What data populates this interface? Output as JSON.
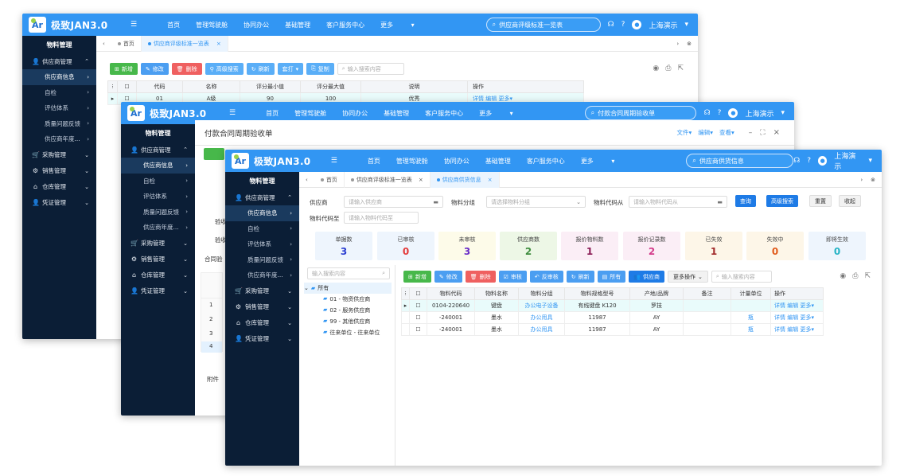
{
  "app": {
    "name": "极致JAN3.0",
    "logo_letter": "Ar"
  },
  "topnav": [
    "首页",
    "管理驾驶舱",
    "协同办公",
    "基础管理",
    "客户服务中心",
    "更多"
  ],
  "user": "上海演示",
  "w1": {
    "search": "供应商评级标准一览表",
    "tabs": [
      "首页",
      "供应商评级标准一览表"
    ],
    "toolbar": [
      "新增",
      "修改",
      "删除",
      "高级搜索",
      "刷新",
      "套打",
      "复制"
    ],
    "search_placeholder": "输入搜索内容",
    "columns": [
      "代码",
      "名称",
      "评分最小值",
      "评分最大值",
      "说明",
      "操作"
    ],
    "rows": [
      [
        "01",
        "A级",
        "90",
        "100",
        "优秀"
      ]
    ],
    "actions": [
      "详情",
      "编辑",
      "更多"
    ]
  },
  "w2": {
    "search": "付款合同周期验收单",
    "title": "付款合同周期验收单",
    "menu": [
      "文件",
      "编辑",
      "查看"
    ],
    "labels": [
      "验收",
      "验收",
      "合同验"
    ],
    "row_nums": [
      "1",
      "2",
      "3",
      "4"
    ],
    "footer": "附件"
  },
  "w3": {
    "search": "供应商供货信息",
    "tabs": [
      "首页",
      "供应商评级标准一览表",
      "供应商供货信息"
    ],
    "filters": {
      "supplier": "供应商",
      "supplier_ph": "请输入供应商",
      "category": "物料分组",
      "category_ph": "请选择物料分组",
      "code_from": "物料代码从",
      "code_from_ph": "请输入物料代码从",
      "code_to": "物料代码至",
      "code_to_ph": "请输入物料代码至"
    },
    "filter_buttons": [
      "查询",
      "高级搜索",
      "重置",
      "收起"
    ],
    "stats": [
      {
        "label": "单据数",
        "value": "3",
        "color": "#2c3fd1",
        "bg": "#eef5fd"
      },
      {
        "label": "已审核",
        "value": "0",
        "color": "#e33a3a",
        "bg": "#eef5fd"
      },
      {
        "label": "未审核",
        "value": "3",
        "color": "#6a2ec8",
        "bg": "#fdfbe9"
      },
      {
        "label": "供应商数",
        "value": "2",
        "color": "#3f8d3f",
        "bg": "#edf7e6"
      },
      {
        "label": "报价物料数",
        "value": "1",
        "color": "#8a1c55",
        "bg": "#fbeef6"
      },
      {
        "label": "报价记录数",
        "value": "2",
        "color": "#d33b8a",
        "bg": "#fbeef6"
      },
      {
        "label": "已失效",
        "value": "1",
        "color": "#a12a2a",
        "bg": "#fdf6e8"
      },
      {
        "label": "失效中",
        "value": "0",
        "color": "#e05b1b",
        "bg": "#fdf6e8"
      },
      {
        "label": "即将生效",
        "value": "0",
        "color": "#26b3c5",
        "bg": "#eef5fd"
      }
    ],
    "tree_search": "输入搜索内容",
    "tree": [
      "所有",
      "01 - 物资供应商",
      "02 - 服务供应商",
      "99 - 其他供应商",
      "往来单位 - 往来单位"
    ],
    "toolbar": [
      "新增",
      "修改",
      "删除",
      "审核",
      "反审核",
      "刷新",
      "所有",
      "供应商",
      "更多操作"
    ],
    "search_placeholder": "输入搜索内容",
    "columns": [
      "物料代码",
      "物料名称",
      "物料分组",
      "物料规格型号",
      "产地/品牌",
      "备注",
      "计量单位",
      "操作"
    ],
    "rows": [
      [
        "0104-220640",
        "键盘",
        "办公电子设备",
        "有线键盘 K120",
        "罗技",
        "",
        ""
      ],
      [
        "-240001",
        "墨水",
        "办公用具",
        "11987",
        "AY",
        "",
        "瓶"
      ],
      [
        "-240001",
        "墨水",
        "办公用具",
        "11987",
        "AY",
        "",
        "瓶"
      ]
    ],
    "actions": [
      "详情",
      "编辑",
      "更多"
    ]
  },
  "sidebar": {
    "title": "物料管理",
    "groups": [
      "供应商管理",
      "采购管理",
      "销售管理",
      "仓库管理",
      "凭证管理"
    ],
    "subs": [
      "供应商信息",
      "自检",
      "评估体系",
      "质量问题反馈",
      "供应商年度..."
    ]
  }
}
